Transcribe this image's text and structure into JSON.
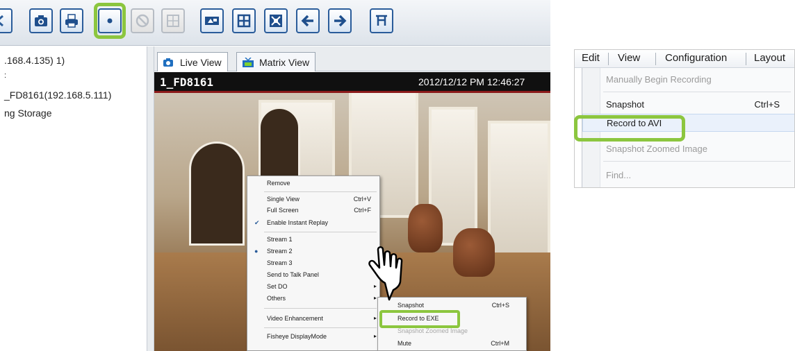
{
  "toolbar": {
    "buttons": [
      {
        "name": "back-partial-icon"
      },
      {
        "name": "snapshot-icon"
      },
      {
        "name": "print-icon"
      },
      {
        "name": "record-icon",
        "highlighted": true
      },
      {
        "name": "stop-icon",
        "disabled": true
      },
      {
        "name": "layout-icon",
        "disabled": true
      },
      {
        "name": "pip-icon"
      },
      {
        "name": "grid-icon"
      },
      {
        "name": "fullscreen-icon"
      },
      {
        "name": "previous-icon"
      },
      {
        "name": "next-icon"
      },
      {
        "name": "ptz-icon"
      }
    ],
    "highlight_color": "#8cc63f"
  },
  "tree": {
    "items": [
      ".168.4.135) 1)",
      ":",
      "_FD8161(192.168.5.111)",
      "ng Storage"
    ]
  },
  "tabs": [
    {
      "label": "Live View",
      "active": true
    },
    {
      "label": "Matrix View",
      "active": false
    }
  ],
  "video": {
    "camera_name": "1_FD8161",
    "timestamp": "2012/12/12 PM 12:46:27"
  },
  "context_menu": {
    "items": [
      {
        "label": "Remove"
      },
      {
        "label": "Single View",
        "shortcut": "Ctrl+V"
      },
      {
        "label": "Full Screen",
        "shortcut": "Ctrl+F"
      },
      {
        "label": "Enable Instant Replay",
        "checked": true
      },
      {
        "label": "Stream 1"
      },
      {
        "label": "Stream 2",
        "selected": true
      },
      {
        "label": "Stream 3"
      },
      {
        "label": "Send to Talk Panel"
      },
      {
        "label": "Set DO",
        "submenu": true
      },
      {
        "label": "Others",
        "submenu": true
      },
      {
        "label": "Video Enhancement",
        "submenu": true
      },
      {
        "label": "Fisheye DisplayMode",
        "submenu": true
      }
    ],
    "submenu": [
      {
        "label": "Snapshot",
        "shortcut": "Ctrl+S"
      },
      {
        "label": "Record to EXE",
        "highlighted": true
      },
      {
        "label": "Snapshot Zoomed Image",
        "dim": true
      },
      {
        "label": "Mute",
        "shortcut": "Ctrl+M"
      }
    ]
  },
  "edit_menu": {
    "menubar": [
      "Edit",
      "View",
      "Configuration",
      "Layout"
    ],
    "items": [
      {
        "label": "Manually Begin Recording",
        "dim": true
      },
      {
        "label": "Snapshot",
        "shortcut": "Ctrl+S"
      },
      {
        "label": "Record to AVI",
        "hover": true,
        "highlighted": true
      },
      {
        "label": "Snapshot Zoomed Image",
        "dim": true
      },
      {
        "label": "Find...",
        "dim": true
      }
    ]
  },
  "colors": {
    "highlight": "#8cc63f",
    "toolbar_border": "#2a5c9a",
    "video_header": "#101010"
  }
}
